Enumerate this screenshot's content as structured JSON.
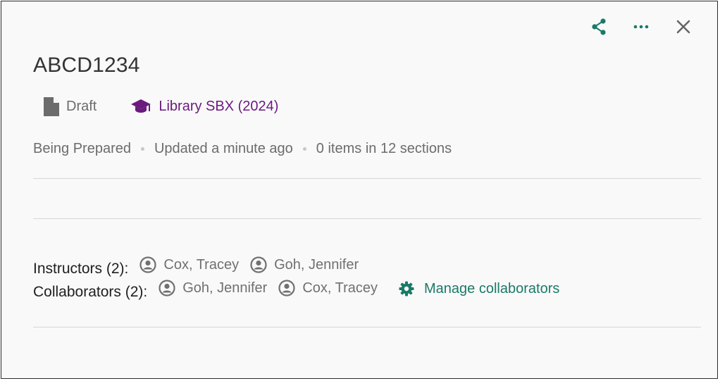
{
  "toolbar": {
    "share_icon": "share-icon",
    "more_icon": "more-horizontal-icon",
    "close_icon": "close-icon",
    "accent": "#1a7a68"
  },
  "list": {
    "title": "ABCD1234",
    "status_badge": "Draft",
    "course": "Library SBX (2024)"
  },
  "status": {
    "state": "Being Prepared",
    "updated": "Updated a minute ago",
    "counts": "0 items in 12 sections"
  },
  "instructors": {
    "label": "Instructors (2):",
    "names": [
      "Cox, Tracey",
      "Goh, Jennifer"
    ]
  },
  "collaborators": {
    "label": "Collaborators (2):",
    "names": [
      "Goh, Jennifer",
      "Cox, Tracey"
    ],
    "manage_label": "Manage collaborators"
  },
  "colors": {
    "course_link": "#6a1b7d",
    "manage_link": "#1a7a68"
  }
}
